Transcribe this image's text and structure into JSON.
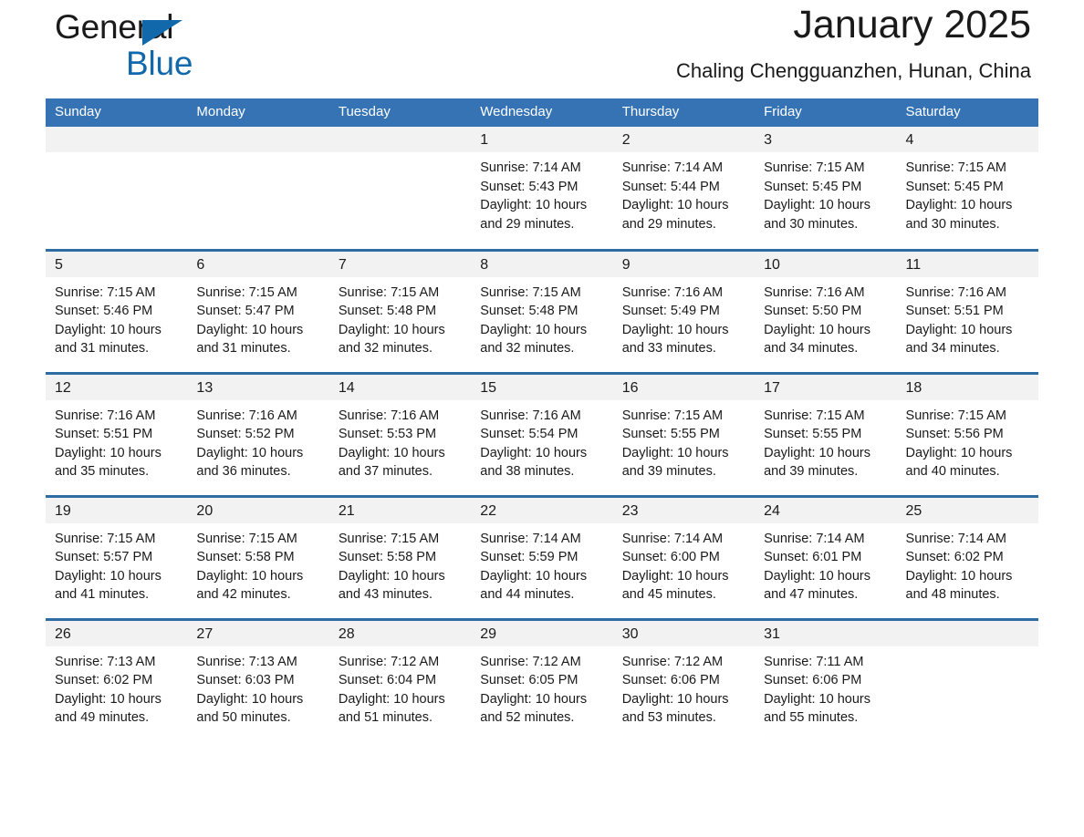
{
  "brand": {
    "name_part1": "General",
    "name_part2": "Blue",
    "flag_icon": "triangle-flag-icon",
    "accent_color": "#1168ab"
  },
  "header": {
    "title": "January 2025",
    "location": "Chaling Chengguanzhen, Hunan, China"
  },
  "theme": {
    "header_blue": "#3573b5",
    "row_border_blue": "#2e6da4",
    "daynum_band_gray": "#f2f2f2",
    "text_color": "#1a1a1a"
  },
  "weekdays": [
    "Sunday",
    "Monday",
    "Tuesday",
    "Wednesday",
    "Thursday",
    "Friday",
    "Saturday"
  ],
  "weeks": [
    [
      {
        "day": "",
        "blank": true
      },
      {
        "day": "",
        "blank": true
      },
      {
        "day": "",
        "blank": true
      },
      {
        "day": "1",
        "sunrise": "Sunrise: 7:14 AM",
        "sunset": "Sunset: 5:43 PM",
        "daylight_l1": "Daylight: 10 hours",
        "daylight_l2": "and 29 minutes."
      },
      {
        "day": "2",
        "sunrise": "Sunrise: 7:14 AM",
        "sunset": "Sunset: 5:44 PM",
        "daylight_l1": "Daylight: 10 hours",
        "daylight_l2": "and 29 minutes."
      },
      {
        "day": "3",
        "sunrise": "Sunrise: 7:15 AM",
        "sunset": "Sunset: 5:45 PM",
        "daylight_l1": "Daylight: 10 hours",
        "daylight_l2": "and 30 minutes."
      },
      {
        "day": "4",
        "sunrise": "Sunrise: 7:15 AM",
        "sunset": "Sunset: 5:45 PM",
        "daylight_l1": "Daylight: 10 hours",
        "daylight_l2": "and 30 minutes."
      }
    ],
    [
      {
        "day": "5",
        "sunrise": "Sunrise: 7:15 AM",
        "sunset": "Sunset: 5:46 PM",
        "daylight_l1": "Daylight: 10 hours",
        "daylight_l2": "and 31 minutes."
      },
      {
        "day": "6",
        "sunrise": "Sunrise: 7:15 AM",
        "sunset": "Sunset: 5:47 PM",
        "daylight_l1": "Daylight: 10 hours",
        "daylight_l2": "and 31 minutes."
      },
      {
        "day": "7",
        "sunrise": "Sunrise: 7:15 AM",
        "sunset": "Sunset: 5:48 PM",
        "daylight_l1": "Daylight: 10 hours",
        "daylight_l2": "and 32 minutes."
      },
      {
        "day": "8",
        "sunrise": "Sunrise: 7:15 AM",
        "sunset": "Sunset: 5:48 PM",
        "daylight_l1": "Daylight: 10 hours",
        "daylight_l2": "and 32 minutes."
      },
      {
        "day": "9",
        "sunrise": "Sunrise: 7:16 AM",
        "sunset": "Sunset: 5:49 PM",
        "daylight_l1": "Daylight: 10 hours",
        "daylight_l2": "and 33 minutes."
      },
      {
        "day": "10",
        "sunrise": "Sunrise: 7:16 AM",
        "sunset": "Sunset: 5:50 PM",
        "daylight_l1": "Daylight: 10 hours",
        "daylight_l2": "and 34 minutes."
      },
      {
        "day": "11",
        "sunrise": "Sunrise: 7:16 AM",
        "sunset": "Sunset: 5:51 PM",
        "daylight_l1": "Daylight: 10 hours",
        "daylight_l2": "and 34 minutes."
      }
    ],
    [
      {
        "day": "12",
        "sunrise": "Sunrise: 7:16 AM",
        "sunset": "Sunset: 5:51 PM",
        "daylight_l1": "Daylight: 10 hours",
        "daylight_l2": "and 35 minutes."
      },
      {
        "day": "13",
        "sunrise": "Sunrise: 7:16 AM",
        "sunset": "Sunset: 5:52 PM",
        "daylight_l1": "Daylight: 10 hours",
        "daylight_l2": "and 36 minutes."
      },
      {
        "day": "14",
        "sunrise": "Sunrise: 7:16 AM",
        "sunset": "Sunset: 5:53 PM",
        "daylight_l1": "Daylight: 10 hours",
        "daylight_l2": "and 37 minutes."
      },
      {
        "day": "15",
        "sunrise": "Sunrise: 7:16 AM",
        "sunset": "Sunset: 5:54 PM",
        "daylight_l1": "Daylight: 10 hours",
        "daylight_l2": "and 38 minutes."
      },
      {
        "day": "16",
        "sunrise": "Sunrise: 7:15 AM",
        "sunset": "Sunset: 5:55 PM",
        "daylight_l1": "Daylight: 10 hours",
        "daylight_l2": "and 39 minutes."
      },
      {
        "day": "17",
        "sunrise": "Sunrise: 7:15 AM",
        "sunset": "Sunset: 5:55 PM",
        "daylight_l1": "Daylight: 10 hours",
        "daylight_l2": "and 39 minutes."
      },
      {
        "day": "18",
        "sunrise": "Sunrise: 7:15 AM",
        "sunset": "Sunset: 5:56 PM",
        "daylight_l1": "Daylight: 10 hours",
        "daylight_l2": "and 40 minutes."
      }
    ],
    [
      {
        "day": "19",
        "sunrise": "Sunrise: 7:15 AM",
        "sunset": "Sunset: 5:57 PM",
        "daylight_l1": "Daylight: 10 hours",
        "daylight_l2": "and 41 minutes."
      },
      {
        "day": "20",
        "sunrise": "Sunrise: 7:15 AM",
        "sunset": "Sunset: 5:58 PM",
        "daylight_l1": "Daylight: 10 hours",
        "daylight_l2": "and 42 minutes."
      },
      {
        "day": "21",
        "sunrise": "Sunrise: 7:15 AM",
        "sunset": "Sunset: 5:58 PM",
        "daylight_l1": "Daylight: 10 hours",
        "daylight_l2": "and 43 minutes."
      },
      {
        "day": "22",
        "sunrise": "Sunrise: 7:14 AM",
        "sunset": "Sunset: 5:59 PM",
        "daylight_l1": "Daylight: 10 hours",
        "daylight_l2": "and 44 minutes."
      },
      {
        "day": "23",
        "sunrise": "Sunrise: 7:14 AM",
        "sunset": "Sunset: 6:00 PM",
        "daylight_l1": "Daylight: 10 hours",
        "daylight_l2": "and 45 minutes."
      },
      {
        "day": "24",
        "sunrise": "Sunrise: 7:14 AM",
        "sunset": "Sunset: 6:01 PM",
        "daylight_l1": "Daylight: 10 hours",
        "daylight_l2": "and 47 minutes."
      },
      {
        "day": "25",
        "sunrise": "Sunrise: 7:14 AM",
        "sunset": "Sunset: 6:02 PM",
        "daylight_l1": "Daylight: 10 hours",
        "daylight_l2": "and 48 minutes."
      }
    ],
    [
      {
        "day": "26",
        "sunrise": "Sunrise: 7:13 AM",
        "sunset": "Sunset: 6:02 PM",
        "daylight_l1": "Daylight: 10 hours",
        "daylight_l2": "and 49 minutes."
      },
      {
        "day": "27",
        "sunrise": "Sunrise: 7:13 AM",
        "sunset": "Sunset: 6:03 PM",
        "daylight_l1": "Daylight: 10 hours",
        "daylight_l2": "and 50 minutes."
      },
      {
        "day": "28",
        "sunrise": "Sunrise: 7:12 AM",
        "sunset": "Sunset: 6:04 PM",
        "daylight_l1": "Daylight: 10 hours",
        "daylight_l2": "and 51 minutes."
      },
      {
        "day": "29",
        "sunrise": "Sunrise: 7:12 AM",
        "sunset": "Sunset: 6:05 PM",
        "daylight_l1": "Daylight: 10 hours",
        "daylight_l2": "and 52 minutes."
      },
      {
        "day": "30",
        "sunrise": "Sunrise: 7:12 AM",
        "sunset": "Sunset: 6:06 PM",
        "daylight_l1": "Daylight: 10 hours",
        "daylight_l2": "and 53 minutes."
      },
      {
        "day": "31",
        "sunrise": "Sunrise: 7:11 AM",
        "sunset": "Sunset: 6:06 PM",
        "daylight_l1": "Daylight: 10 hours",
        "daylight_l2": "and 55 minutes."
      },
      {
        "day": "",
        "blank": true,
        "empty_tail": true
      }
    ]
  ]
}
